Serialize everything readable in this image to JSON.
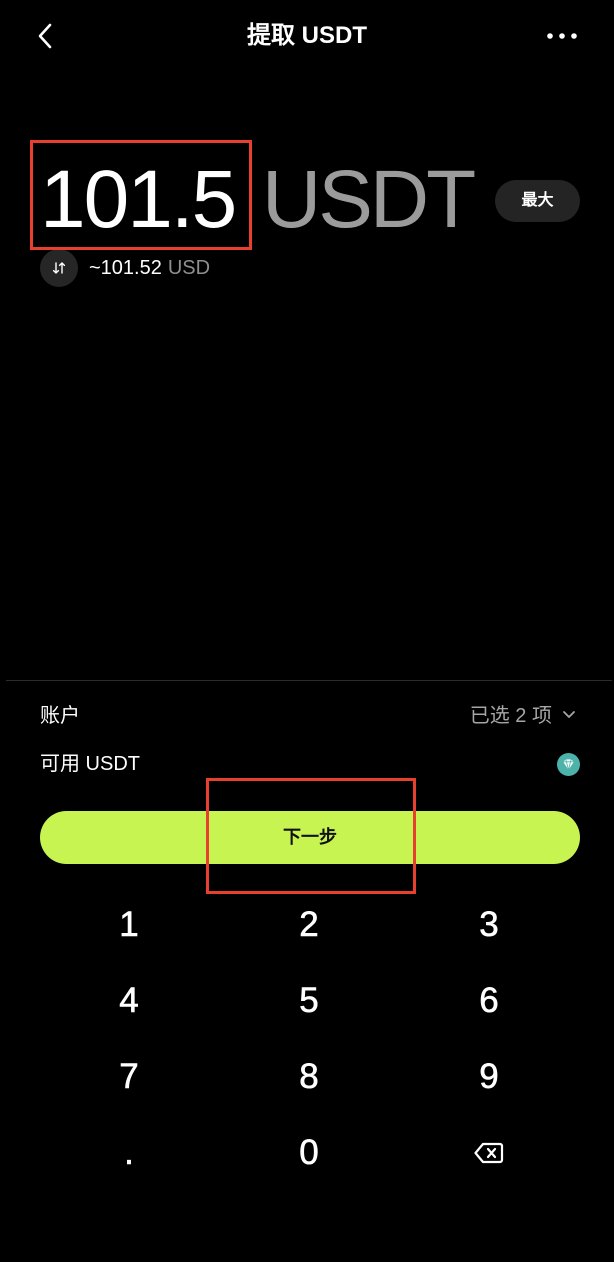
{
  "header": {
    "title": "提取 USDT",
    "back_icon": "chevron-left-icon",
    "more_icon": "more-horizontal-icon"
  },
  "amount": {
    "value": "101.5",
    "currency": "USDT",
    "max_label": "最大"
  },
  "conversion": {
    "icon": "swap-vertical-icon",
    "value": "~101.52",
    "currency": "USD"
  },
  "account": {
    "label": "账户",
    "selected": "已选 2 项",
    "chevron_icon": "chevron-down-icon"
  },
  "available": {
    "label": "可用 USDT",
    "icon": "tron-diamond-icon"
  },
  "next_button": {
    "label": "下一步"
  },
  "keypad": {
    "keys": [
      "1",
      "2",
      "3",
      "4",
      "5",
      "6",
      "7",
      "8",
      "9",
      ".",
      "0"
    ],
    "backspace_icon": "backspace-icon"
  },
  "colors": {
    "background": "#000000",
    "accent": "#C8F452",
    "muted_text": "#9B9B9B",
    "highlight": "#E8402E",
    "tron_teal": "#4DB3AA"
  }
}
